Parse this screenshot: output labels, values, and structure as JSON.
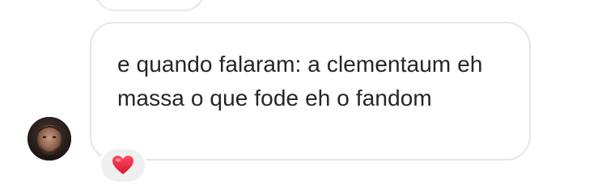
{
  "message": {
    "text": "e quando falaram: a clementaum eh massa o que fode eh o fandom",
    "reaction": {
      "icon": "red-heart-icon",
      "color": "#e0245e"
    }
  },
  "sender": {
    "avatar_icon": "user-avatar"
  },
  "colors": {
    "bubble_border": "#e6e6e6",
    "text": "#262626",
    "reaction_bg": "#efefef"
  }
}
